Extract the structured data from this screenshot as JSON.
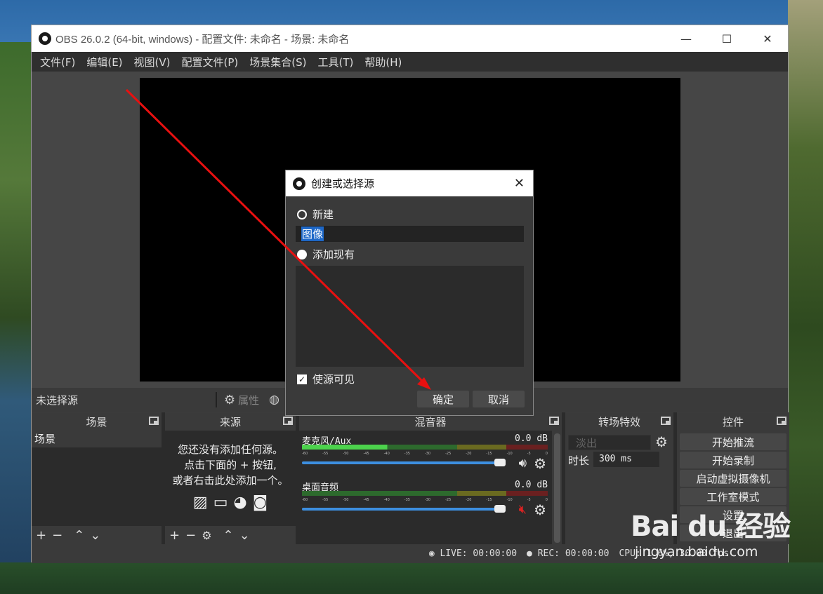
{
  "window": {
    "title": "OBS 26.0.2 (64-bit, windows) - 配置文件: 未命名 - 场景: 未命名",
    "controls": {
      "minimize": "—",
      "maximize": "☐",
      "close": "✕"
    }
  },
  "menu": [
    "文件(F)",
    "编辑(E)",
    "视图(V)",
    "配置文件(P)",
    "场景集合(S)",
    "工具(T)",
    "帮助(H)"
  ],
  "source_bar": {
    "no_source": "未选择源",
    "properties": "属性"
  },
  "docks": {
    "scenes": {
      "title": "场景",
      "items": [
        "场景"
      ]
    },
    "sources": {
      "title": "来源",
      "hint_line1": "您还没有添加任何源。",
      "hint_line2": "点击下面的 + 按钮,",
      "hint_line3": "或者右击此处添加一个。"
    },
    "mixer": {
      "title": "混音器",
      "ticks": [
        "-60",
        "-55",
        "-50",
        "-45",
        "-40",
        "-35",
        "-30",
        "-25",
        "-20",
        "-15",
        "-10",
        "-5",
        "0"
      ],
      "channels": [
        {
          "name": "麦克风/Aux",
          "db": "0.0 dB",
          "muted": false
        },
        {
          "name": "桌面音频",
          "db": "0.0 dB",
          "muted": true
        }
      ]
    },
    "transitions": {
      "title": "转场特效",
      "selected": "淡出",
      "duration_label": "时长",
      "duration_value": "300 ms"
    },
    "controls": {
      "title": "控件",
      "buttons": [
        "开始推流",
        "开始录制",
        "启动虚拟摄像机",
        "工作室模式",
        "设置",
        "退出"
      ]
    }
  },
  "status": {
    "live": "LIVE: 00:00:00",
    "rec": "REC: 00:00:00",
    "cpu": "CPU: 1.6%, 30.00 fps"
  },
  "dialog": {
    "title": "创建或选择源",
    "new_label": "新建",
    "name_value": "图像",
    "add_existing_label": "添加现有",
    "visible_label": "使源可见",
    "ok": "确定",
    "cancel": "取消"
  },
  "watermark": {
    "main": "Bai du 经验",
    "sub": "jingyan.baidu.com"
  },
  "colors": {
    "annotation": "#e81010",
    "accent": "#3d8fe0",
    "muted": "#dd2222"
  }
}
